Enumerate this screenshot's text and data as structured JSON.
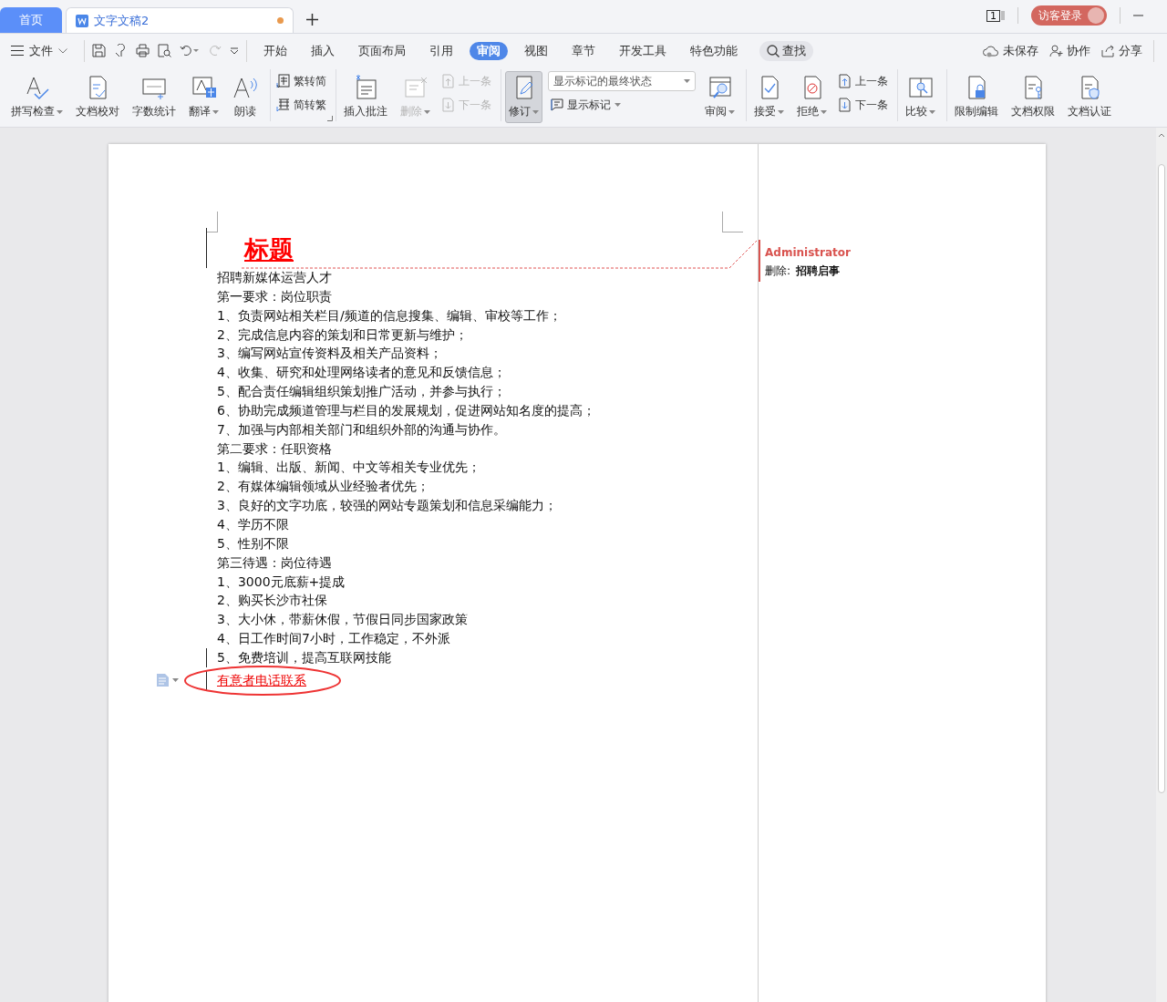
{
  "tabs": [
    {
      "label": "首页",
      "kind": "home",
      "selected": false,
      "unsaved": false
    },
    {
      "label": "文字文稿2",
      "kind": "doc",
      "selected": true,
      "unsaved": true
    }
  ],
  "titlebar": {
    "page_count": "1",
    "login": "访客登录"
  },
  "menu": {
    "file": "文件",
    "tabs": [
      {
        "label": "开始",
        "selected": false
      },
      {
        "label": "插入",
        "selected": false
      },
      {
        "label": "页面布局",
        "selected": false
      },
      {
        "label": "引用",
        "selected": false
      },
      {
        "label": "审阅",
        "selected": true
      },
      {
        "label": "视图",
        "selected": false
      },
      {
        "label": "章节",
        "selected": false
      },
      {
        "label": "开发工具",
        "selected": false
      },
      {
        "label": "特色功能",
        "selected": false
      }
    ],
    "search": "查找",
    "actions": [
      "未保存",
      "协作",
      "分享"
    ]
  },
  "ribbon": {
    "groups": [
      {
        "columns": [
          [
            {
              "kind": "large",
              "label": "拼写检查",
              "dropdown": true,
              "disabled": false,
              "pressed": false
            }
          ],
          [
            {
              "kind": "large",
              "label": "文档校对",
              "dropdown": false,
              "disabled": false,
              "pressed": false
            }
          ],
          [
            {
              "kind": "large",
              "label": "字数统计",
              "dropdown": false,
              "disabled": false,
              "pressed": false
            }
          ],
          [
            {
              "kind": "large",
              "label": "翻译",
              "dropdown": true,
              "disabled": false,
              "pressed": false
            }
          ],
          [
            {
              "kind": "large",
              "label": "朗读",
              "dropdown": false,
              "disabled": false,
              "pressed": false
            }
          ]
        ]
      },
      {
        "launcher": true,
        "columns": [
          [
            {
              "kind": "small",
              "label": "繁转简",
              "dropdown": false,
              "disabled": false
            },
            {
              "kind": "small",
              "label": "简转繁",
              "dropdown": false,
              "disabled": false
            }
          ]
        ]
      },
      {
        "columns": [
          [
            {
              "kind": "large",
              "label": "插入批注",
              "dropdown": false,
              "disabled": false,
              "pressed": false
            }
          ],
          [
            {
              "kind": "large",
              "label": "删除",
              "dropdown": true,
              "disabled": true,
              "pressed": false
            }
          ],
          [
            {
              "kind": "small",
              "label": "上一条",
              "dropdown": false,
              "disabled": true
            },
            {
              "kind": "small",
              "label": "下一条",
              "dropdown": false,
              "disabled": true
            }
          ]
        ]
      },
      {
        "columns": [
          [
            {
              "kind": "large",
              "label": "修订",
              "dropdown": true,
              "disabled": false,
              "pressed": true
            }
          ],
          [
            {
              "kind": "select",
              "value": "显示标记的最终状态"
            },
            {
              "kind": "small",
              "label": "显示标记",
              "dropdown": true,
              "disabled": false
            }
          ],
          [
            {
              "kind": "large",
              "label": "审阅",
              "dropdown": true,
              "disabled": false,
              "pressed": false
            }
          ]
        ]
      },
      {
        "columns": [
          [
            {
              "kind": "large",
              "label": "接受",
              "dropdown": true,
              "disabled": false,
              "pressed": false
            }
          ],
          [
            {
              "kind": "large",
              "label": "拒绝",
              "dropdown": true,
              "disabled": false,
              "pressed": false
            }
          ],
          [
            {
              "kind": "small",
              "label": "上一条",
              "dropdown": false,
              "disabled": false
            },
            {
              "kind": "small",
              "label": "下一条",
              "dropdown": false,
              "disabled": false
            }
          ]
        ]
      },
      {
        "columns": [
          [
            {
              "kind": "large",
              "label": "比较",
              "dropdown": true,
              "disabled": false,
              "pressed": false
            }
          ]
        ]
      },
      {
        "columns": [
          [
            {
              "kind": "large",
              "label": "限制编辑",
              "dropdown": false,
              "disabled": false,
              "pressed": false
            }
          ],
          [
            {
              "kind": "large",
              "label": "文档权限",
              "dropdown": false,
              "disabled": false,
              "pressed": false
            }
          ],
          [
            {
              "kind": "large",
              "label": "文档认证",
              "dropdown": false,
              "disabled": false,
              "pressed": false
            }
          ]
        ]
      }
    ]
  },
  "document": {
    "heading": {
      "text": "标题",
      "kind": "insert"
    },
    "lines": [
      {
        "text": "招聘新媒体运营人才",
        "kind": "plain",
        "circled": false
      },
      {
        "text": "第一要求：岗位职责",
        "kind": "plain",
        "circled": false
      },
      {
        "text": "1、负责网站相关栏目/频道的信息搜集、编辑、审校等工作；",
        "kind": "plain",
        "circled": false
      },
      {
        "text": "2、完成信息内容的策划和日常更新与维护；",
        "kind": "plain",
        "circled": false
      },
      {
        "text": "3、编写网站宣传资料及相关产品资料；",
        "kind": "plain",
        "circled": false
      },
      {
        "text": "4、收集、研究和处理网络读者的意见和反馈信息；",
        "kind": "plain",
        "circled": false
      },
      {
        "text": "5、配合责任编辑组织策划推广活动，并参与执行；",
        "kind": "plain",
        "circled": false
      },
      {
        "text": "6、协助完成频道管理与栏目的发展规划，促进网站知名度的提高；",
        "kind": "plain",
        "circled": false
      },
      {
        "text": "7、加强与内部相关部门和组织外部的沟通与协作。",
        "kind": "plain",
        "circled": false
      },
      {
        "text": "第二要求：任职资格",
        "kind": "plain",
        "circled": false
      },
      {
        "text": "1、编辑、出版、新闻、中文等相关专业优先；",
        "kind": "plain",
        "circled": false
      },
      {
        "text": "2、有媒体编辑领域从业经验者优先；",
        "kind": "plain",
        "circled": false
      },
      {
        "text": "3、良好的文字功底，较强的网站专题策划和信息采编能力；",
        "kind": "plain",
        "circled": false
      },
      {
        "text": "4、学历不限",
        "kind": "plain",
        "circled": false
      },
      {
        "text": "5、性别不限",
        "kind": "plain",
        "circled": false
      },
      {
        "text": "第三待遇：岗位待遇",
        "kind": "plain",
        "circled": false
      },
      {
        "text": "1、3000元底薪+提成",
        "kind": "plain",
        "circled": false
      },
      {
        "text": "2、购买长沙市社保",
        "kind": "plain",
        "circled": false
      },
      {
        "text": "3、大小休，带薪休假，节假日同步国家政策",
        "kind": "plain",
        "circled": false
      },
      {
        "text": "4、日工作时间7小时，工作稳定，不外派",
        "kind": "plain",
        "circled": false
      },
      {
        "text": "5、免费培训，提高互联网技能",
        "kind": "changed",
        "circled": false
      },
      {
        "text": "有意者电话联系",
        "kind": "insert",
        "circled": true
      }
    ],
    "comment": {
      "author": "Administrator",
      "label": "删除:",
      "text": "招聘启事"
    }
  }
}
